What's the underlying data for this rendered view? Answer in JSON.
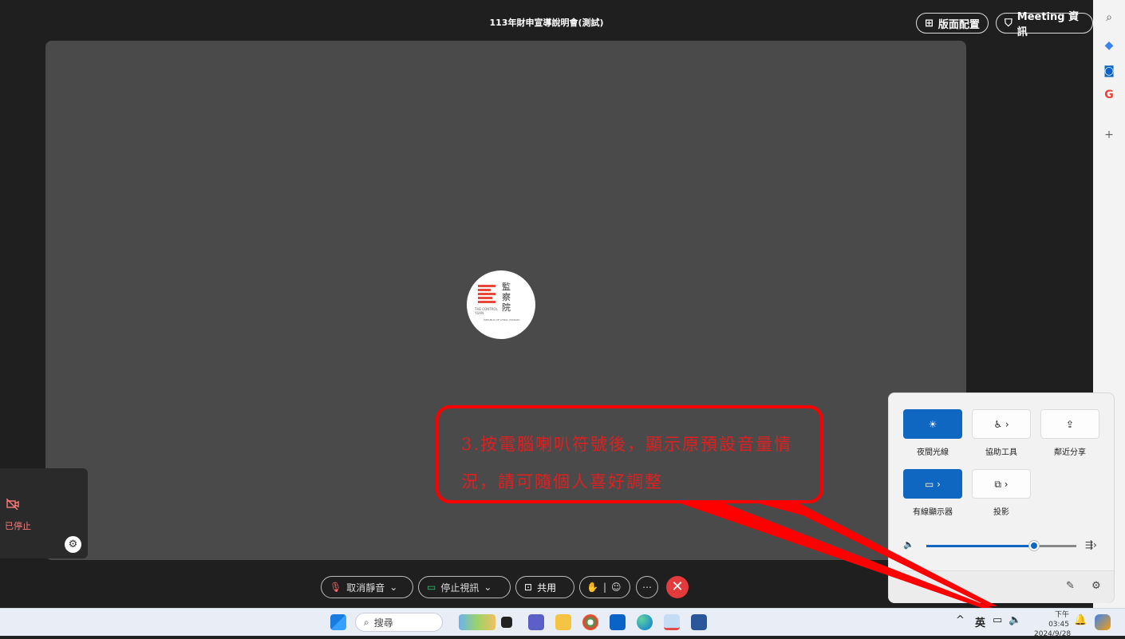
{
  "meeting": {
    "title": "113年財申宣導說明會(測試)",
    "layout_button": "版面配置",
    "info_button": "Meeting 資訊"
  },
  "logo": {
    "name_chars": [
      "監",
      "察",
      "院"
    ],
    "tag_line": "THE CONTROL YUAN",
    "subtitle": "REPUBLIC OF CHINA (TAIWAN)"
  },
  "selfview": {
    "status": "已停止"
  },
  "controls": {
    "unmute": "取消靜音",
    "stop_video": "停止視訊",
    "share": "共用",
    "more": "⋯",
    "end": "✕"
  },
  "rail": {
    "icons": [
      "search-icon",
      "copilot-icon",
      "outlook-icon",
      "google-icon",
      "add-icon"
    ],
    "add": "+"
  },
  "quick_settings": {
    "tiles": [
      {
        "label": "夜間光線",
        "on": true,
        "icon": "☀"
      },
      {
        "label": "協助工具",
        "on": false,
        "icon": "♿ ›"
      },
      {
        "label": "鄰近分享",
        "on": false,
        "icon": "⇪"
      },
      {
        "label": "有線顯示器",
        "on": true,
        "icon": "▭ ›"
      },
      {
        "label": "投影",
        "on": false,
        "icon": "⧉ ›"
      }
    ],
    "volume_percent": 72
  },
  "annotation": {
    "text": "3.按電腦喇叭符號後，顯示原預設音量情況，請可隨個人喜好調整"
  },
  "taskbar": {
    "search_placeholder": "搜尋",
    "ime": "英",
    "time": "下午 03:45",
    "date": "2024/9/28"
  },
  "colors": {
    "accent": "#1067c2",
    "danger": "#e33b3b",
    "annotation": "#ff0000"
  }
}
